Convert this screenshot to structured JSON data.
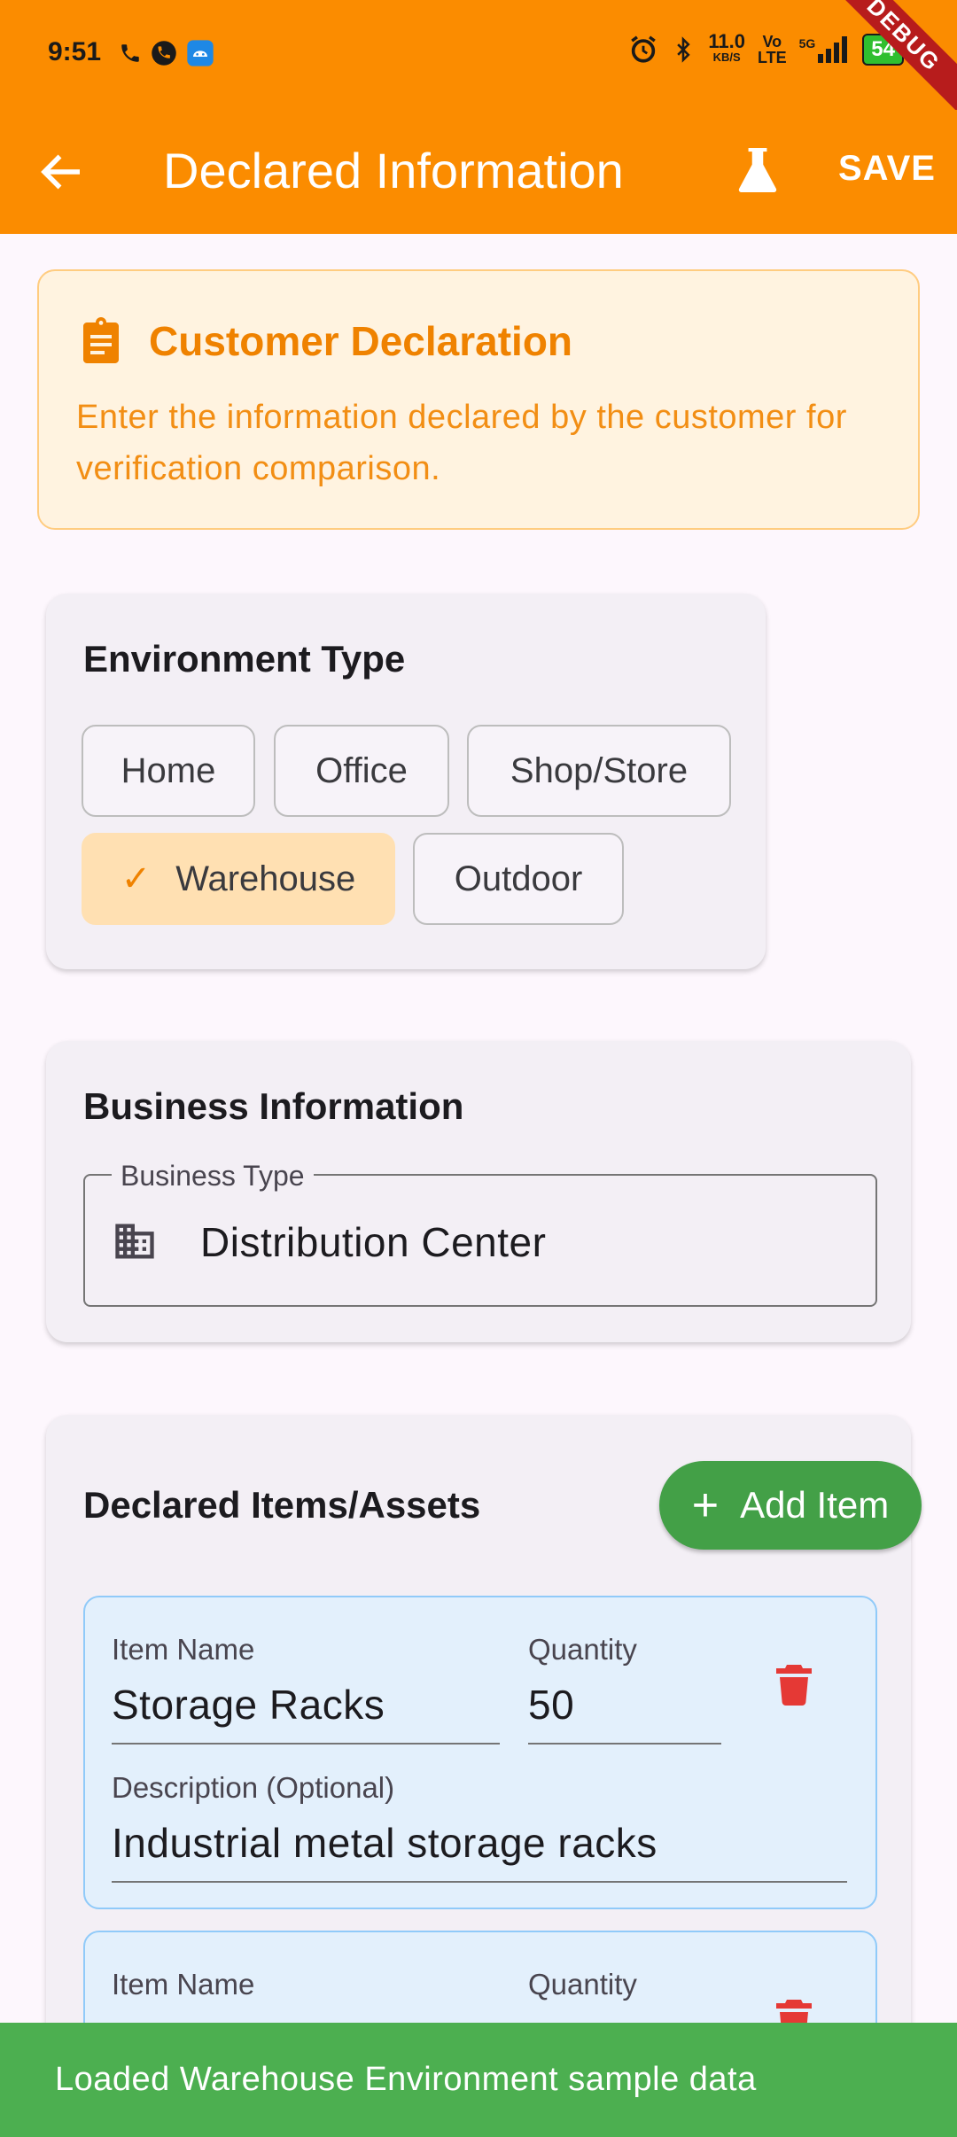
{
  "status_bar": {
    "time": "9:51",
    "net_speed": "11.0",
    "net_unit": "KB/S",
    "volte_top": "Vo",
    "volte_bottom": "LTE",
    "network": "5G",
    "battery": "54",
    "debug_label": "DEBUG"
  },
  "app_bar": {
    "title": "Declared Information",
    "save_label": "SAVE",
    "accent_color": "#fb8c00"
  },
  "banner": {
    "title": "Customer Declaration",
    "text": "Enter the information declared by the customer for verification comparison."
  },
  "environment": {
    "title": "Environment Type",
    "options": [
      "Home",
      "Office",
      "Shop/Store",
      "Warehouse",
      "Outdoor"
    ],
    "selected": "Warehouse"
  },
  "business": {
    "title": "Business Information",
    "field_label": "Business Type",
    "field_value": "Distribution Center"
  },
  "items": {
    "title": "Declared Items/Assets",
    "add_label": "Add Item",
    "name_label": "Item Name",
    "quantity_label": "Quantity",
    "description_label": "Description (Optional)",
    "list": [
      {
        "name": "Storage Racks",
        "quantity": "50",
        "description": "Industrial metal storage racks"
      },
      {
        "name": "",
        "quantity": "",
        "description": ""
      }
    ]
  },
  "snackbar": {
    "message": "Loaded Warehouse Environment sample data",
    "color": "#4caf50"
  }
}
